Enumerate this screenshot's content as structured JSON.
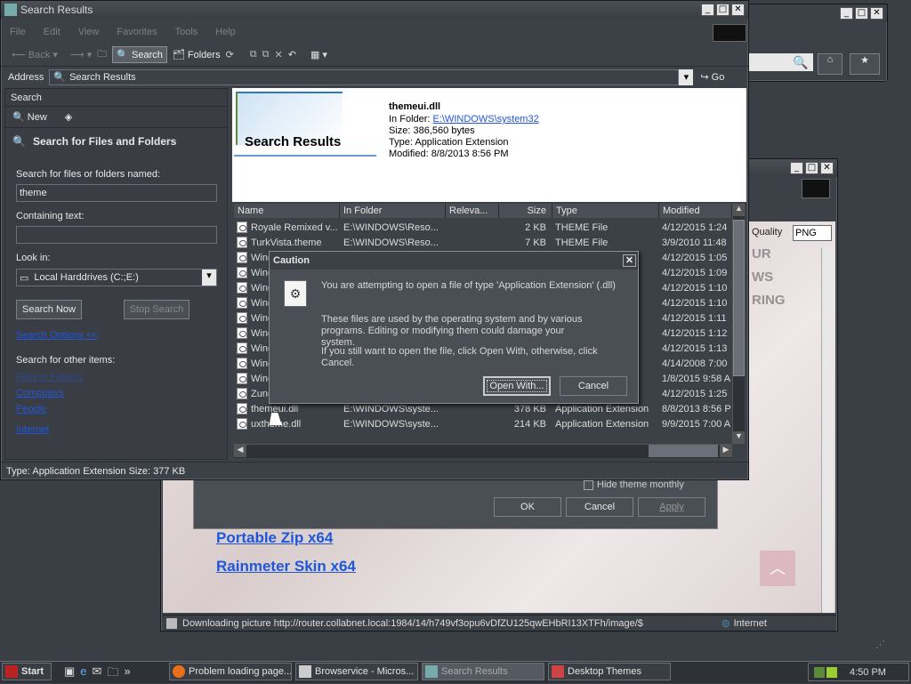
{
  "search_window": {
    "title": "Search Results",
    "menu": [
      "File",
      "Edit",
      "View",
      "Favorites",
      "Tools",
      "Help"
    ],
    "toolbar": {
      "back": "Back",
      "search": "Search",
      "folders": "Folders"
    },
    "address_label": "Address",
    "address_value": "Search Results",
    "go": "Go"
  },
  "search_pane": {
    "header": "Search",
    "new": "New",
    "section_title": "Search for Files and Folders",
    "named_label": "Search for files or folders named:",
    "named_value": "theme",
    "containing_label": "Containing text:",
    "look_in_label": "Look in:",
    "look_in_value": "Local Harddrives (C:;E:)",
    "search_now": "Search Now",
    "stop_search": "Stop Search",
    "search_options": "Search Options <<",
    "other_items_label": "Search for other items:",
    "other_items": [
      "Files or Folders",
      "Computers",
      "People",
      "Internet"
    ]
  },
  "preview": {
    "banner": "Search Results",
    "file": "themeui.dll",
    "in_folder_label": "In Folder:",
    "in_folder": "E:\\WINDOWS\\system32",
    "size": "Size: 386,560 bytes",
    "type": "Type: Application Extension",
    "modified": "Modified: 8/8/2013 8:56 PM"
  },
  "columns": [
    "Name",
    "In Folder",
    "Releva...",
    "Size",
    "Type",
    "Modified"
  ],
  "rows": [
    {
      "name": "Royale Remixed v...",
      "folder": "E:\\WINDOWS\\Reso...",
      "size": "2 KB",
      "type": "THEME File",
      "modified": "4/12/2015 1:24"
    },
    {
      "name": "TurkVista.theme",
      "folder": "E:\\WINDOWS\\Reso...",
      "size": "7 KB",
      "type": "THEME File",
      "modified": "3/9/2010 11:48"
    },
    {
      "name": "Wind",
      "folder": "",
      "size": "",
      "type": "",
      "modified": "4/12/2015 1:05"
    },
    {
      "name": "Wind",
      "folder": "",
      "size": "",
      "type": "",
      "modified": "4/12/2015 1:09"
    },
    {
      "name": "Wind",
      "folder": "",
      "size": "",
      "type": "",
      "modified": "4/12/2015 1:10"
    },
    {
      "name": "Wind",
      "folder": "",
      "size": "",
      "type": "",
      "modified": "4/12/2015 1:10"
    },
    {
      "name": "Wind",
      "folder": "",
      "size": "",
      "type": "",
      "modified": "4/12/2015 1:11"
    },
    {
      "name": "Wind",
      "folder": "",
      "size": "",
      "type": "",
      "modified": "4/12/2015 1:12"
    },
    {
      "name": "Wind",
      "folder": "",
      "size": "",
      "type": "",
      "modified": "4/12/2015 1:13"
    },
    {
      "name": "Wind",
      "folder": "",
      "size": "",
      "type": "",
      "modified": "4/14/2008 7:00"
    },
    {
      "name": "Wind",
      "folder": "",
      "size": "",
      "type": "",
      "modified": "1/8/2015 9:58 A"
    },
    {
      "name": "Zune",
      "folder": "",
      "size": "",
      "type": "",
      "modified": "4/12/2015 1:25"
    },
    {
      "name": "themeui.dll",
      "folder": "E:\\WINDOWS\\syste...",
      "size": "378 KB",
      "type": "Application Extension",
      "modified": "8/8/2013 8:56 P"
    },
    {
      "name": "uxtheme.dll",
      "folder": "E:\\WINDOWS\\syste...",
      "size": "214 KB",
      "type": "Application Extension",
      "modified": "9/9/2015 7:00 A"
    }
  ],
  "status_bar": "Type: Application Extension Size: 377 KB",
  "dialog": {
    "title": "Caution",
    "line1": "You are attempting to open a file of type 'Application Extension' (.dll)",
    "line2": "These files are used by the operating system and by various programs. Editing or modifying them could damage your system.",
    "line3": "If you still want to open the file, click Open With, otherwise, click Cancel.",
    "open_with": "Open With...",
    "cancel": "Cancel"
  },
  "background": {
    "quality_label": "Quality",
    "quality_value": "PNG",
    "web_text": [
      "UR",
      "WS",
      "RING"
    ],
    "checkbox_label": "Hide theme monthly",
    "ok": "OK",
    "cancel": "Cancel",
    "apply": "Apply",
    "links": [
      "Portable Zip x64",
      "Rainmeter Skin x64"
    ],
    "ie_status": "Downloading picture http://router.collabnet.local:1984/14/h749vf3opu6vDfZU125qwEHbRI13XTFh/image/$",
    "ie_zone": "Internet"
  },
  "taskbar": {
    "start": "Start",
    "items": [
      "Problem loading page...",
      "Browservice - Micros...",
      "Search Results",
      "Desktop Themes"
    ],
    "clock": "4:50 PM"
  },
  "colors": {
    "link": "#1f57d8",
    "desktop": "#3a3f45",
    "dialog_bg": "#4a4f56"
  }
}
